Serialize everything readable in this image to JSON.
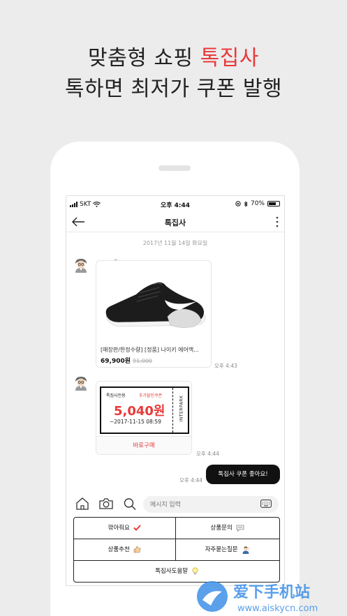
{
  "hero": {
    "line1_prefix": "맞춤형 쇼핑",
    "line1_accent": "톡집사",
    "line2": "톡하면 최저가 쿠폰 발행"
  },
  "status_bar": {
    "carrier": "SKT",
    "time": "오후 4:44",
    "battery": "70%",
    "battery_level": 0.7
  },
  "chat": {
    "title": "톡집사",
    "date": "2017년 11월 14일 화요일",
    "product": {
      "name": "[매장판/한정수량] [정품] 나이키 에어맥...",
      "price": "69,900원",
      "original_price": "91,000",
      "time": "오후 4:43"
    },
    "coupon": {
      "label": "톡집사전용",
      "sublabel": "추가할인쿠폰",
      "amount": "5,040원",
      "expiry": "~2017-11-15 08:59",
      "brand": "INTERPARK",
      "button": "바로구매",
      "time": "오후 4:44"
    },
    "my_message": {
      "text": "톡집사 쿠폰 좋아요!",
      "time": "오후 4:44"
    }
  },
  "input": {
    "placeholder": "메시지 입력"
  },
  "quick_menu": {
    "items": [
      "깎아줘요",
      "상품문의",
      "상품추천",
      "자주묻는질문",
      "톡집사도움말"
    ]
  },
  "colors": {
    "accent": "#e8393a",
    "dark": "#111111"
  }
}
